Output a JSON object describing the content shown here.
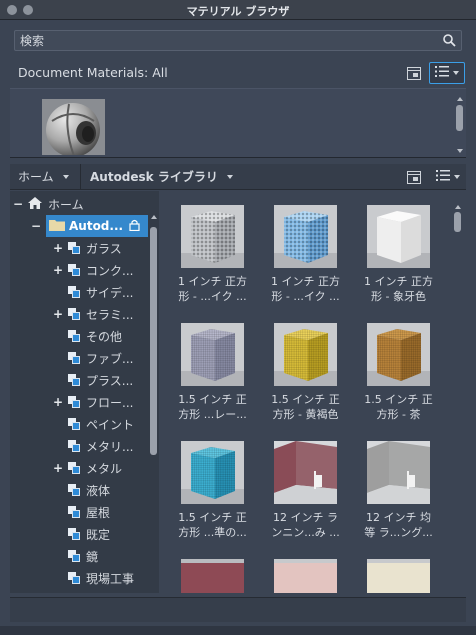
{
  "window": {
    "title": "マテリアル ブラウザ"
  },
  "search": {
    "placeholder": "検索"
  },
  "document_materials": {
    "label": "Document Materials: All"
  },
  "library_nav": {
    "home": "ホーム",
    "library": "Autodesk ライブラリ"
  },
  "tree": {
    "root": "ホーム",
    "library": "Autod...",
    "items": [
      {
        "label": "ガラス",
        "expandable": true
      },
      {
        "label": "コンク...",
        "expandable": true
      },
      {
        "label": "サイデ...",
        "expandable": false
      },
      {
        "label": "セラミ...",
        "expandable": true
      },
      {
        "label": "その他",
        "expandable": false
      },
      {
        "label": "ファブ...",
        "expandable": false
      },
      {
        "label": "プラス...",
        "expandable": false
      },
      {
        "label": "フロー...",
        "expandable": true
      },
      {
        "label": "ペイント",
        "expandable": false
      },
      {
        "label": "メタリ...",
        "expandable": false
      },
      {
        "label": "メタル",
        "expandable": true
      },
      {
        "label": "液体",
        "expandable": false
      },
      {
        "label": "屋根",
        "expandable": false
      },
      {
        "label": "既定",
        "expandable": false
      },
      {
        "label": "鏡",
        "expandable": false
      },
      {
        "label": "現場工事",
        "expandable": false
      }
    ]
  },
  "materials": [
    {
      "line1": "1 インチ 正方",
      "line2": "形 - ...イク ...",
      "swatch": "mosaic-gray"
    },
    {
      "line1": "1 インチ 正方",
      "line2": "形 - ...イク ...",
      "swatch": "mosaic-blue"
    },
    {
      "line1": "1 インチ 正方",
      "line2": "形 - 象牙色",
      "swatch": "ivory"
    },
    {
      "line1": "1.5 インチ 正",
      "line2": "方形 ...レー...",
      "swatch": "tile-gray"
    },
    {
      "line1": "1.5 インチ 正",
      "line2": "方形 - 黄褐色",
      "swatch": "tile-yellow"
    },
    {
      "line1": "1.5 インチ 正",
      "line2": "方形 - 茶",
      "swatch": "tile-brown"
    },
    {
      "line1": "1.5 インチ 正",
      "line2": "方形 ...準の...",
      "swatch": "tile-cyan"
    },
    {
      "line1": "12 インチ ラ",
      "line2": "ンニン...み ...",
      "swatch": "room-red"
    },
    {
      "line1": "12 インチ 均",
      "line2": "等 ラ...ング...",
      "swatch": "room-gray"
    },
    {
      "line1": "",
      "line2": "",
      "swatch": "partial-red"
    },
    {
      "line1": "",
      "line2": "",
      "swatch": "partial-pink"
    },
    {
      "line1": "",
      "line2": "",
      "swatch": "partial-beige"
    }
  ],
  "colors": {
    "accent": "#3b9fe8",
    "selection": "#3588cc",
    "panel": "#3b4453",
    "folder": "#e8d9a8"
  },
  "icons": {
    "search": "search-icon",
    "list_view": "list-view-icon",
    "panel_toggle": "panel-toggle-icon",
    "home": "home-icon",
    "folder": "folder-icon",
    "lock": "lock-icon",
    "material": "material-icon"
  }
}
